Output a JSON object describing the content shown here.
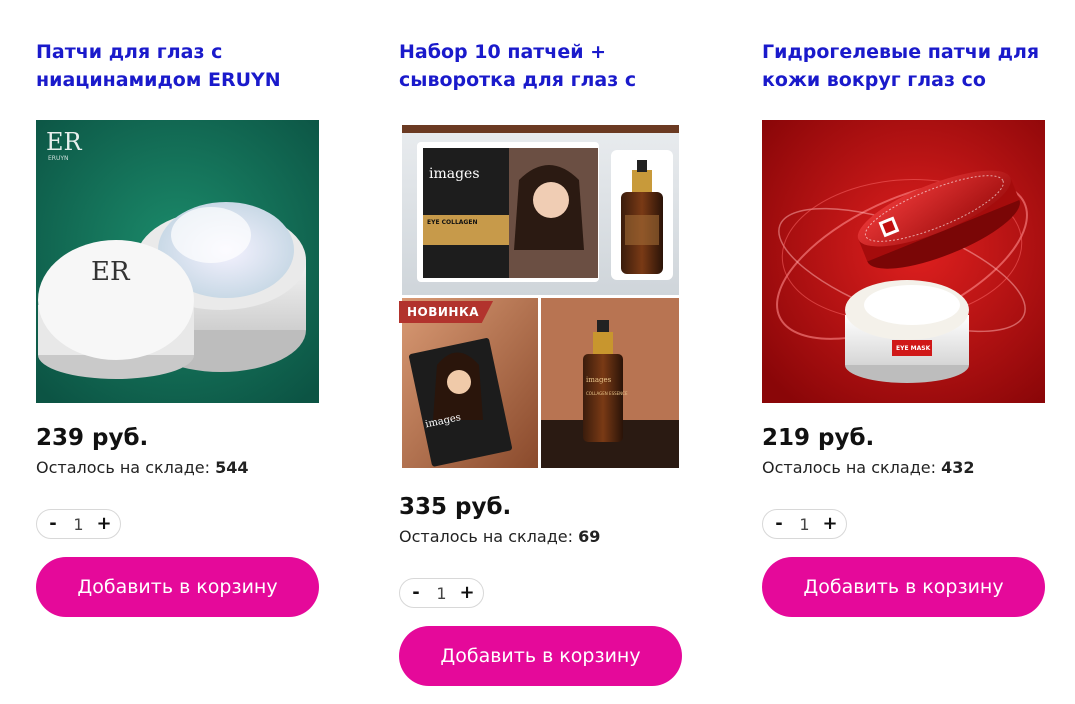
{
  "currency_suffix": " руб.",
  "stock_label": "Осталось на складе: ",
  "add_to_cart_label": "Добавить в корзину",
  "products": [
    {
      "title": "Патчи для глаз с ниацинамидом ERUYN ICE",
      "price": "239 руб.",
      "stock": "544",
      "qty": "1",
      "image_logo": "ER",
      "image_brand": "ERUYN",
      "badge": ""
    },
    {
      "title": "Набор 10 патчей + сыворотка для глаз с",
      "price": "335 руб.",
      "stock": "69",
      "qty": "1",
      "image_brand": "images",
      "image_product": "EYE COLLAGEN",
      "image_serum": "COLLAGEN ESSENCE",
      "badge": "НОВИНКА"
    },
    {
      "title": "Гидрогелевые патчи для кожи вокруг глаз со",
      "price": "219 руб.",
      "stock": "432",
      "qty": "1",
      "image_product": "EYE MASK",
      "badge": ""
    }
  ],
  "colors": {
    "title": "#1a1acb",
    "button": "#e5099a",
    "badge": "#b2332d"
  }
}
